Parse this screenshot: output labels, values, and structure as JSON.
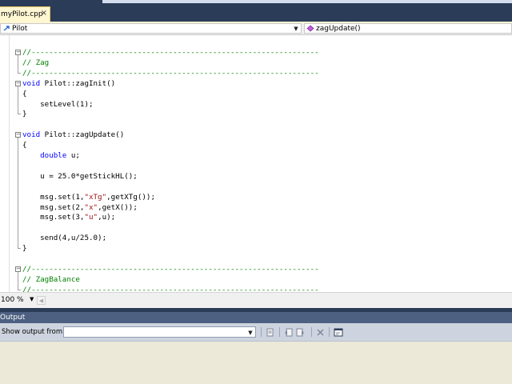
{
  "tab": {
    "label": "myPilot.cpp",
    "close_glyph": "×"
  },
  "nav": {
    "class_selector": "Pilot",
    "member_selector": "zagUpdate()",
    "class_icon": "arrow-icon",
    "member_icon": "method-icon"
  },
  "editor": {
    "lines": [
      [
        {
          "t": "//-----------------------------------------------------------------",
          "c": "comment"
        }
      ],
      [
        {
          "t": "// Zag",
          "c": "comment"
        }
      ],
      [
        {
          "t": "//-----------------------------------------------------------------",
          "c": "comment"
        }
      ],
      [
        {
          "t": "void",
          "c": "kw"
        },
        {
          "t": " Pilot::zagInit()",
          "c": ""
        }
      ],
      [
        {
          "t": "{",
          "c": ""
        }
      ],
      [
        {
          "t": "    setLevel(1);",
          "c": ""
        }
      ],
      [
        {
          "t": "}",
          "c": ""
        }
      ],
      [],
      [
        {
          "t": "void",
          "c": "kw"
        },
        {
          "t": " Pilot::zagUpdate()",
          "c": ""
        }
      ],
      [
        {
          "t": "{",
          "c": ""
        }
      ],
      [
        {
          "t": "    ",
          "c": ""
        },
        {
          "t": "double",
          "c": "kw"
        },
        {
          "t": " u;",
          "c": ""
        }
      ],
      [],
      [
        {
          "t": "    u = 25.0*getStickHL();",
          "c": ""
        }
      ],
      [],
      [
        {
          "t": "    msg.set(1,",
          "c": ""
        },
        {
          "t": "\"xTg\"",
          "c": "str"
        },
        {
          "t": ",getXTg());",
          "c": ""
        }
      ],
      [
        {
          "t": "    msg.set(2,",
          "c": ""
        },
        {
          "t": "\"x\"",
          "c": "str"
        },
        {
          "t": ",getX());",
          "c": ""
        }
      ],
      [
        {
          "t": "    msg.set(3,",
          "c": ""
        },
        {
          "t": "\"u\"",
          "c": "str"
        },
        {
          "t": ",u);",
          "c": ""
        }
      ],
      [],
      [
        {
          "t": "    send(4,u/25.0);",
          "c": ""
        }
      ],
      [
        {
          "t": "}",
          "c": ""
        }
      ],
      [],
      [
        {
          "t": "//-----------------------------------------------------------------",
          "c": "comment"
        }
      ],
      [
        {
          "t": "// ZagBalance",
          "c": "comment"
        }
      ],
      [
        {
          "t": "//-----------------------------------------------------------------",
          "c": "comment"
        }
      ]
    ]
  },
  "zoom": {
    "value": "100 %"
  },
  "output": {
    "title": "Output",
    "show_from_label": "Show output from:",
    "source_value": "",
    "toolbar_icons": [
      "find-message-icon",
      "goto-prev-icon",
      "goto-next-icon",
      "clear-all-icon",
      "word-wrap-icon"
    ]
  },
  "colors": {
    "chrome": "#2b3c59",
    "tab_active": "#fff6d2",
    "comment": "#008000",
    "keyword": "#0000ff",
    "string": "#a31515",
    "output_header": "#4d6082"
  }
}
